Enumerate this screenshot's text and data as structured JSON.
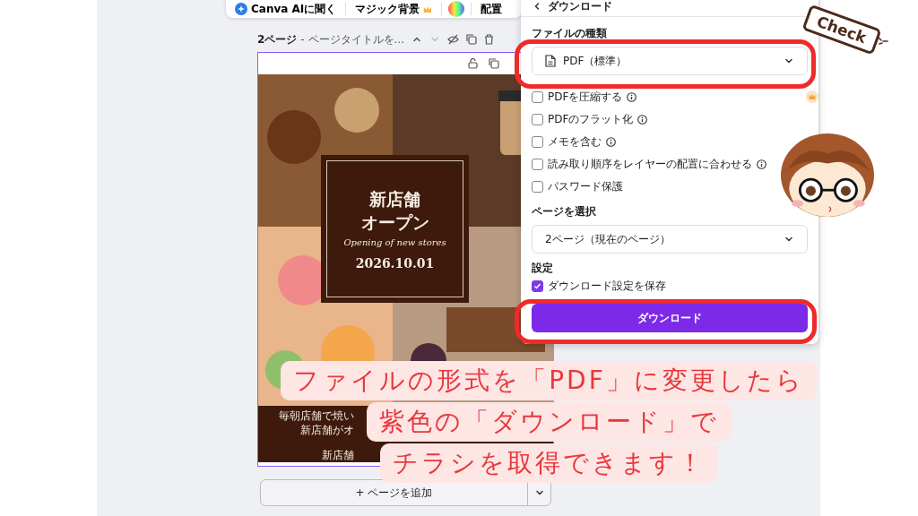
{
  "toolbar": {
    "items": [
      {
        "kind": "ai",
        "label": "Canva AIに聞く"
      },
      {
        "kind": "premium",
        "label": "マジック背景"
      },
      {
        "kind": "color"
      },
      {
        "kind": "text",
        "label": "配置"
      }
    ]
  },
  "page_header": {
    "title": "2ページ",
    "subtitle": "- ページタイトルを..."
  },
  "flyer": {
    "title_lines": [
      "新店舗",
      "オープン"
    ],
    "tagline": "Opening of new stores",
    "date": "2026.10.01",
    "footer_lines": [
      "毎朝店舗で焼い",
      "新店舗がオ",
      "新店舗"
    ]
  },
  "add_page": {
    "label": "+ ページを追加"
  },
  "download_panel": {
    "title": "ダウンロード",
    "file_type_label": "ファイルの種類",
    "file_type": "PDF（標準）",
    "options": [
      {
        "label": "PDFを圧縮する",
        "checked": false,
        "info": true,
        "premium": true
      },
      {
        "label": "PDFのフラット化",
        "checked": false,
        "info": true
      },
      {
        "label": "メモを含む",
        "checked": false,
        "info": true
      },
      {
        "label": "読み取り順序をレイヤーの配置に合わせる",
        "checked": false,
        "info": true
      },
      {
        "label": "パスワード保護",
        "checked": false,
        "info": false
      }
    ],
    "page_label": "ページを選択",
    "page_value": "2ページ（現在のページ）",
    "settings_label": "設定",
    "save_settings": {
      "label": "ダウンロード設定を保存",
      "checked": true
    },
    "download_button": "ダウンロード"
  },
  "annotation": {
    "check_tag": "Check",
    "caption_lines": [
      "ファイルの形式を「PDF」に変更したら",
      "紫色の「ダウンロード」で",
      "チラシを取得できます！"
    ]
  }
}
